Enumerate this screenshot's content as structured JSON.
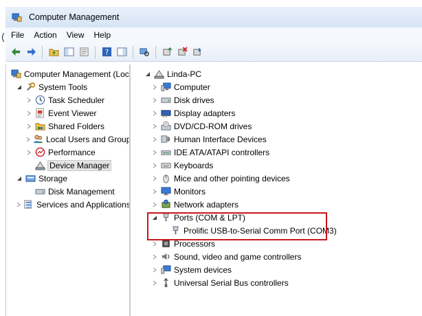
{
  "window": {
    "title": "Computer Management"
  },
  "menu": [
    "File",
    "Action",
    "View",
    "Help"
  ],
  "toolbar": {
    "buttons": [
      "back-icon",
      "forward-icon",
      "up-folder-icon",
      "show-hide-tree-icon",
      "properties-icon",
      "help-icon",
      "show-action-pane-icon",
      "scan-hardware-icon",
      "update-driver-icon",
      "uninstall-icon",
      "disable-icon"
    ]
  },
  "left_tree": [
    {
      "label": "Computer Management (Local",
      "icon": "computer-management-icon",
      "expander": "none",
      "indent": 0
    },
    {
      "label": "System Tools",
      "icon": "system-tools-icon",
      "expander": "open",
      "indent": 1
    },
    {
      "label": "Task Scheduler",
      "icon": "task-scheduler-icon",
      "expander": "closed",
      "indent": 2
    },
    {
      "label": "Event Viewer",
      "icon": "event-viewer-icon",
      "expander": "closed",
      "indent": 2
    },
    {
      "label": "Shared Folders",
      "icon": "shared-folders-icon",
      "expander": "closed",
      "indent": 2
    },
    {
      "label": "Local Users and Groups",
      "icon": "local-users-icon",
      "expander": "closed",
      "indent": 2
    },
    {
      "label": "Performance",
      "icon": "performance-icon",
      "expander": "closed",
      "indent": 2
    },
    {
      "label": "Device Manager",
      "icon": "device-manager-icon",
      "expander": "none",
      "indent": 2,
      "selected": true
    },
    {
      "label": "Storage",
      "icon": "storage-icon",
      "expander": "open",
      "indent": 1
    },
    {
      "label": "Disk Management",
      "icon": "disk-management-icon",
      "expander": "none",
      "indent": 2
    },
    {
      "label": "Services and Applications",
      "icon": "services-icon",
      "expander": "closed",
      "indent": 1
    }
  ],
  "device_tree": [
    {
      "label": "Linda-PC",
      "icon": "computer-root-icon",
      "expander": "open",
      "indent": 0
    },
    {
      "label": "Computer",
      "icon": "computer-icon",
      "expander": "closed",
      "indent": 1
    },
    {
      "label": "Disk drives",
      "icon": "disk-drive-icon",
      "expander": "closed",
      "indent": 1
    },
    {
      "label": "Display adapters",
      "icon": "display-adapter-icon",
      "expander": "closed",
      "indent": 1
    },
    {
      "label": "DVD/CD-ROM drives",
      "icon": "dvd-drive-icon",
      "expander": "closed",
      "indent": 1
    },
    {
      "label": "Human Interface Devices",
      "icon": "hid-icon",
      "expander": "closed",
      "indent": 1
    },
    {
      "label": "IDE ATA/ATAPI controllers",
      "icon": "ide-controller-icon",
      "expander": "closed",
      "indent": 1
    },
    {
      "label": "Keyboards",
      "icon": "keyboard-icon",
      "expander": "closed",
      "indent": 1
    },
    {
      "label": "Mice and other pointing devices",
      "icon": "mouse-icon",
      "expander": "closed",
      "indent": 1
    },
    {
      "label": "Monitors",
      "icon": "monitor-icon",
      "expander": "closed",
      "indent": 1
    },
    {
      "label": "Network adapters",
      "icon": "network-adapter-icon",
      "expander": "closed",
      "indent": 1
    },
    {
      "label": "Ports (COM & LPT)",
      "icon": "port-icon",
      "expander": "open",
      "indent": 1
    },
    {
      "label": "Prolific USB-to-Serial Comm Port (COM3)",
      "icon": "port-device-icon",
      "expander": "none",
      "indent": 2
    },
    {
      "label": "Processors",
      "icon": "processor-icon",
      "expander": "closed",
      "indent": 1
    },
    {
      "label": "Sound, video and game controllers",
      "icon": "sound-icon",
      "expander": "closed",
      "indent": 1
    },
    {
      "label": "System devices",
      "icon": "system-devices-icon",
      "expander": "closed",
      "indent": 1
    },
    {
      "label": "Universal Serial Bus controllers",
      "icon": "usb-icon",
      "expander": "closed",
      "indent": 1
    }
  ],
  "colors": {
    "highlight_border": "#c8161d",
    "selected_bg": "#e5e5e5"
  }
}
